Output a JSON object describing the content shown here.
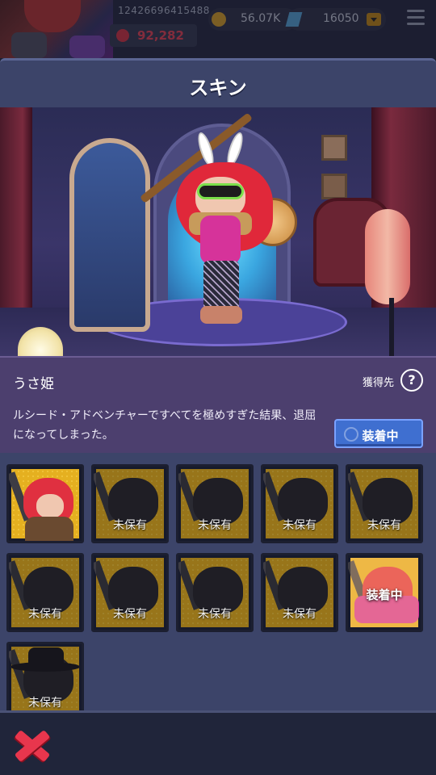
{
  "header": {
    "player_id": "12426696415488",
    "power": "92,282",
    "gold": "56.07K",
    "gems": "16050"
  },
  "modal": {
    "title": "スキン"
  },
  "skin": {
    "name": "うさ姫",
    "source_label": "獲得先",
    "help": "?",
    "description": "ルシード・アドベンチャーですべてを極めすぎた結果、退屈になってしまった。",
    "equip_button": "装着中"
  },
  "grid": {
    "tiles": [
      {
        "variant": "owned",
        "label": ""
      },
      {
        "variant": "locked",
        "label": "未保有"
      },
      {
        "variant": "locked",
        "label": "未保有"
      },
      {
        "variant": "locked",
        "label": "未保有"
      },
      {
        "variant": "locked",
        "label": "未保有"
      },
      {
        "variant": "locked",
        "label": "未保有"
      },
      {
        "variant": "locked",
        "label": "未保有"
      },
      {
        "variant": "locked",
        "label": "未保有"
      },
      {
        "variant": "locked",
        "label": "未保有"
      },
      {
        "variant": "equipped",
        "label": "装着中"
      },
      {
        "variant": "locked-hat",
        "label": "未保有"
      }
    ]
  },
  "colors": {
    "panel": "#3c4469",
    "tile_gold": "#e5b020",
    "accent_blue": "#3f6fd0",
    "close_red": "#e8364d"
  },
  "icons": {
    "close": "close-x-icon",
    "help": "help-circle-icon",
    "menu": "hamburger-menu-icon",
    "gold": "gold-coin-icon",
    "gem": "gem-icon",
    "power": "heart-icon"
  }
}
